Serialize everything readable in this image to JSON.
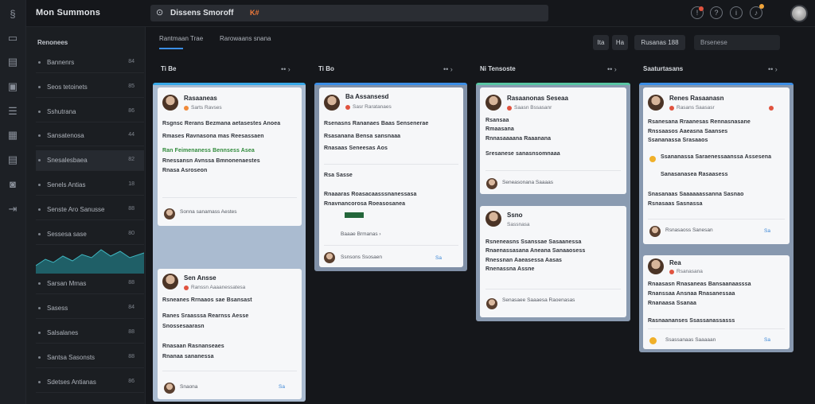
{
  "app": {
    "title": "Mon Summons"
  },
  "search": {
    "value": "Dissens Smoroff",
    "badge": "K#"
  },
  "rail": {
    "icons": [
      "logo-icon",
      "inbox-icon",
      "board-icon",
      "image-icon",
      "layers-icon",
      "calendar-icon",
      "doc-icon",
      "storage-icon",
      "logout-icon"
    ]
  },
  "topbar_icons": [
    "notification-icon",
    "help-icon",
    "info-icon",
    "bell-icon"
  ],
  "sidebar": {
    "title": "Renonees",
    "items": [
      {
        "label": "Bannenrs",
        "count": "84"
      },
      {
        "label": "Seos tetoinets",
        "count": "85"
      },
      {
        "label": "Sshutrana",
        "count": "86"
      },
      {
        "label": "Sansatenosa",
        "count": "44"
      },
      {
        "label": "Snesalesbaea",
        "count": "82"
      },
      {
        "label": "Senels Antias",
        "count": "18"
      },
      {
        "label": "Senste Aro Sanusse",
        "count": "88"
      },
      {
        "label": "Sessesa sase",
        "count": "80"
      },
      {
        "label": "Sarsan Mmas",
        "count": "88"
      },
      {
        "label": "Sasess",
        "count": "84"
      },
      {
        "label": "Salsalanes",
        "count": "88"
      },
      {
        "label": "Santsa Sasonsts",
        "count": "88"
      },
      {
        "label": "Sdetses Antianas",
        "count": "86"
      }
    ]
  },
  "tabs": [
    "Rantmaan Trae",
    "Rarowaans snana"
  ],
  "toolbar": {
    "btn1": "Ita",
    "btn2": "Ha",
    "btn3": "Rusanas 188",
    "filter": "Brsenese"
  },
  "columns": [
    {
      "title": "Ti Be",
      "menu": "•• ›"
    },
    {
      "title": "Ti Bo",
      "menu": "•• ›"
    },
    {
      "title": "Ni Tensoste",
      "menu": "•• ›"
    },
    {
      "title": "Saaturtasans",
      "menu": "•• ›"
    }
  ],
  "cards": {
    "c1": {
      "who": "Rasaaneas",
      "meta": "Sarts Ravses",
      "lines": [
        "Rsgnsc Rerans Bezmana aetasestes Anoea",
        "Rmases Ravnasona mas Reesassaen",
        "Ran Feimenaness Bennsess Asea",
        "Rnessansn Avnssa Bmnonenaestes",
        "Rnasa Asroseon"
      ],
      "foot": "Sonna sanamass Aestes"
    },
    "c2": {
      "who": "Sen Ansse",
      "meta": "Ranssn Aaaanessatesa",
      "lines": [
        "Rsneanes Rrnaaos sae Bsansast",
        "Ranes Sraasssa Rearnss Aesse",
        "Snossesaarasn",
        "Rnasaan Rasnanseaes",
        "Rnanaa sananessa"
      ],
      "foot": "Snaona",
      "fr": "Sa"
    },
    "c3": {
      "who": "Ba Assansesd",
      "meta": "Sasr Raratanaes",
      "lines": [
        "Rsenasns Rananaes Baas Sensenerae",
        "Rsasanana Bensa sansnaaa",
        "Rnasaas Seneesas Aos"
      ],
      "sub": "Rsa Sasse",
      "lines2": [
        "Rnaaaras Roasacaasssnanessasa",
        "Rnavnancorosa Roeasosanea"
      ],
      "tags": "Baaae Brmanas ›",
      "foot": "Ssnsons Ssosaen",
      "fr": "Sa"
    },
    "c4": {
      "who": "Rasaanonas Seseaa",
      "meta": "Saasn Bssasanr",
      "lines": [
        "Rsansaa",
        "Rmaasana",
        "Rnnasaaaana Raaanana",
        "Sresanese sanasnsomnaaa"
      ],
      "foot": "Seneasonana Saaaas"
    },
    "c5": {
      "who": "Ssno",
      "meta": "Sassnasa",
      "lines": [
        "Rsneneasns Ssanssae Sasaanessa",
        "Rnaenassasana Aneana Sanaaosess",
        "Rnessnan Aaeasessa Aasas",
        "Rnenassna Assne"
      ],
      "foot": "Senasaee Saaaesa Raoenasas"
    },
    "c6": {
      "who": "Renes Rasaanasn",
      "meta": "Rasans Saasasr",
      "lines": [
        "Rsanesana Rraanesas Rennasnasane",
        "Rnssaasos Aaeasna Saanses",
        "Ssananassa Srasaaos"
      ],
      "l2": [
        "Ssananassa Saraenessaanssa Assesena",
        "Sanasanasea Rasaasess"
      ],
      "l3": [
        "Snasanaas Saaaaaassanna Sasnao",
        "Rsnasaas Sasnassa"
      ],
      "foot": "Rsnasaoss Sanesan",
      "fr": "Sa"
    },
    "c7": {
      "who": "Rea",
      "meta": "Rsanasana",
      "lines": [
        "Rnaasasn Rnasaneas Bansaanaasssa",
        "Rnanssaa Ansnaa Rnasanessaa",
        "Rnanaasa Ssanaa"
      ],
      "l2": [
        "Rasnaananses Ssassanassasss"
      ],
      "foot": "Ssassanaas Saaaaan",
      "fr": "Sa"
    }
  }
}
